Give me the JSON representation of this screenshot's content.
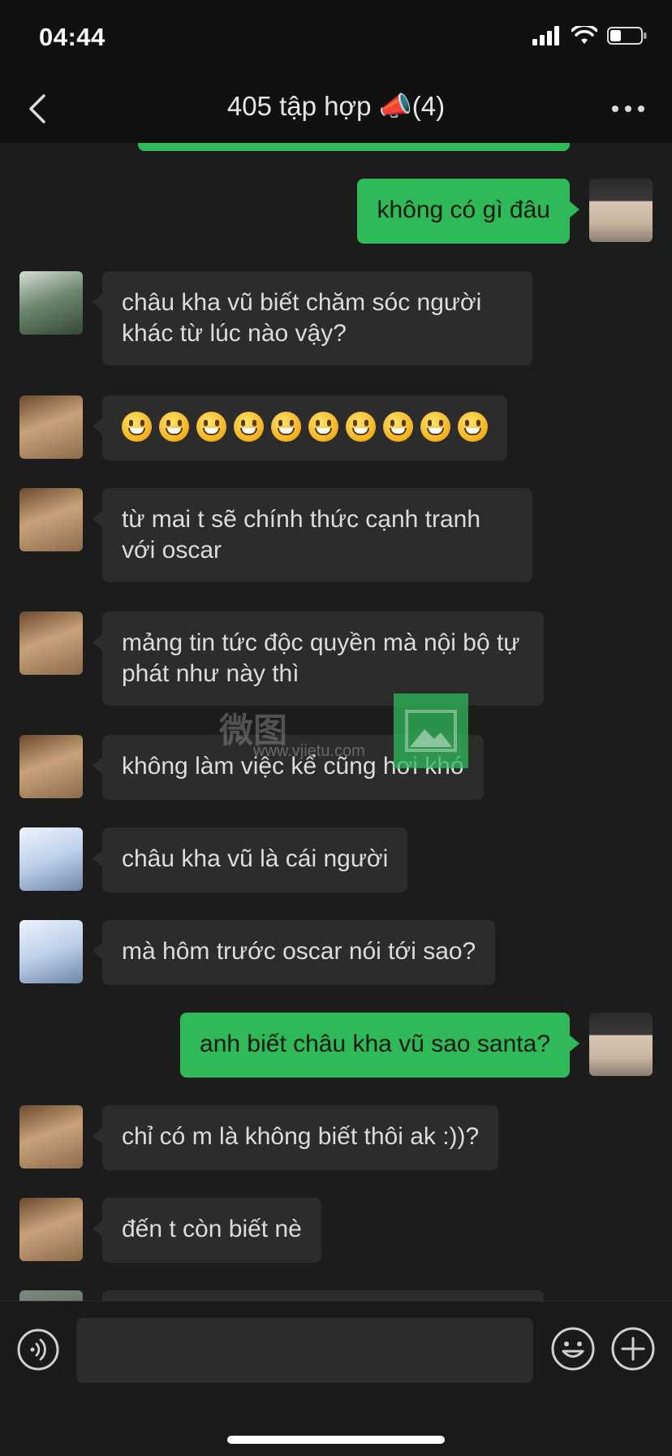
{
  "status_bar": {
    "time": "04:44",
    "battery_level": 0.35
  },
  "nav": {
    "title": "405 tập hợp 📣(4)"
  },
  "messages": [
    {
      "side": "out",
      "text": "không có gì đâu"
    },
    {
      "side": "in",
      "text": "châu kha vũ biết chăm sóc người khác từ lúc nào vậy?"
    },
    {
      "side": "in",
      "text": "😀😀😀😀😀😀😀😀😀😀",
      "emoji_count": 10
    },
    {
      "side": "in",
      "text": "từ mai t sẽ chính thức cạnh tranh với oscar"
    },
    {
      "side": "in",
      "text": "mảng tin tức độc quyền mà nội bộ tự phát như này thì"
    },
    {
      "side": "in",
      "text": "không làm việc kể cũng hơi khó"
    },
    {
      "side": "in",
      "text": "châu kha vũ là cái người"
    },
    {
      "side": "in",
      "text": "mà hôm trước oscar nói tới sao?"
    },
    {
      "side": "out",
      "text": "anh biết châu kha vũ sao santa?"
    },
    {
      "side": "in",
      "text": "chỉ có m là không biết thôi ak :))?"
    },
    {
      "side": "in",
      "text": "đến t còn biết nè"
    }
  ],
  "watermark": {
    "text": "微图",
    "url": "www.vjietu.com"
  },
  "input": {
    "placeholder": "",
    "value": ""
  },
  "colors": {
    "outgoing_bubble": "#2fb959",
    "incoming_bubble": "#2c2c2c",
    "chat_background": "#1c1c1c",
    "bar_background": "#111111"
  },
  "icons": [
    "back-chevron-icon",
    "more-dots-icon",
    "voice-icon",
    "emoji-icon",
    "plus-icon"
  ]
}
